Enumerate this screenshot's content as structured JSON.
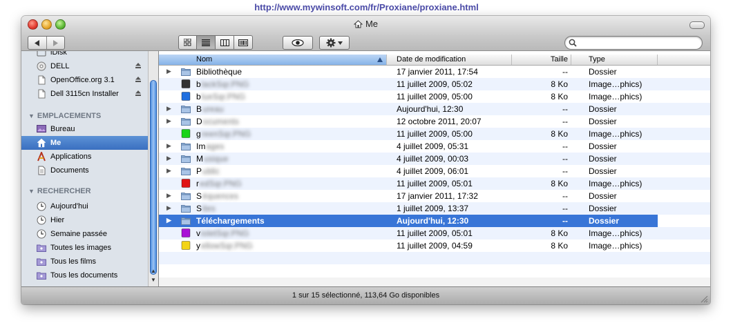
{
  "url_banner": "http://www.mywinsoft.com/fr/Proxiane/proxiane.html",
  "window": {
    "title": "Me"
  },
  "sidebar": {
    "devices": [
      {
        "label": "iDisk",
        "icon": "idisk-icon",
        "eject": false
      },
      {
        "label": "DELL",
        "icon": "disk-icon",
        "eject": true
      },
      {
        "label": "OpenOffice.org 3.1",
        "icon": "volume-icon",
        "eject": true
      },
      {
        "label": "Dell 3115cn Installer",
        "icon": "volume-icon",
        "eject": true
      }
    ],
    "places_header": "EMPLACEMENTS",
    "places": [
      {
        "label": "Bureau",
        "icon": "desktop-icon",
        "selected": false
      },
      {
        "label": "Me",
        "icon": "home-icon",
        "selected": true
      },
      {
        "label": "Applications",
        "icon": "applications-icon",
        "selected": false
      },
      {
        "label": "Documents",
        "icon": "documents-icon",
        "selected": false
      }
    ],
    "search_header": "RECHERCHER",
    "searches": [
      {
        "label": "Aujourd'hui",
        "icon": "clock-icon"
      },
      {
        "label": "Hier",
        "icon": "clock-icon"
      },
      {
        "label": "Semaine passée",
        "icon": "clock-icon"
      },
      {
        "label": "Toutes les images",
        "icon": "smart-folder-icon"
      },
      {
        "label": "Tous les films",
        "icon": "smart-folder-icon"
      },
      {
        "label": "Tous les documents",
        "icon": "smart-folder-icon"
      }
    ]
  },
  "columns": {
    "name": "Nom",
    "date": "Date de modification",
    "size": "Taille",
    "type": "Type"
  },
  "files": [
    {
      "prefix": "Bibliothèque",
      "blurred": "",
      "date": "17 janvier 2011, 17:54",
      "size": "--",
      "type": "Dossier",
      "kind": "folder",
      "color": "#8fb0d8",
      "selected": false
    },
    {
      "prefix": "b",
      "blurred": "lackSqr.PNG",
      "date": "11 juillet 2009, 05:02",
      "size": "8 Ko",
      "type": "Image…phics)",
      "kind": "image",
      "color": "#333333",
      "selected": false
    },
    {
      "prefix": "b",
      "blurred": "lueSqr.PNG",
      "date": "11 juillet 2009, 05:00",
      "size": "8 Ko",
      "type": "Image…phics)",
      "kind": "image",
      "color": "#1f6fe0",
      "selected": false
    },
    {
      "prefix": "B",
      "blurred": "ureau",
      "date": "Aujourd'hui, 12:30",
      "size": "--",
      "type": "Dossier",
      "kind": "folder",
      "color": "#8fb0d8",
      "selected": false
    },
    {
      "prefix": "D",
      "blurred": "ocuments",
      "date": "12 octobre 2011, 20:07",
      "size": "--",
      "type": "Dossier",
      "kind": "folder",
      "color": "#8fb0d8",
      "selected": false
    },
    {
      "prefix": "g",
      "blurred": "reenSqr.PNG",
      "date": "11 juillet 2009, 05:00",
      "size": "8 Ko",
      "type": "Image…phics)",
      "kind": "image",
      "color": "#19d419",
      "selected": false
    },
    {
      "prefix": "Im",
      "blurred": "ages",
      "date": "4 juillet 2009, 05:31",
      "size": "--",
      "type": "Dossier",
      "kind": "folder",
      "color": "#8fb0d8",
      "selected": false
    },
    {
      "prefix": "M",
      "blurred": "usique",
      "date": "4 juillet 2009, 00:03",
      "size": "--",
      "type": "Dossier",
      "kind": "folder",
      "color": "#8fb0d8",
      "selected": false
    },
    {
      "prefix": "P",
      "blurred": "ublic",
      "date": "4 juillet 2009, 06:01",
      "size": "--",
      "type": "Dossier",
      "kind": "folder",
      "color": "#8fb0d8",
      "selected": false
    },
    {
      "prefix": "r",
      "blurred": "edSqr.PNG",
      "date": "11 juillet 2009, 05:01",
      "size": "8 Ko",
      "type": "Image…phics)",
      "kind": "image",
      "color": "#e01515",
      "selected": false
    },
    {
      "prefix": "S",
      "blurred": "équences",
      "date": "17 janvier 2011, 17:32",
      "size": "--",
      "type": "Dossier",
      "kind": "folder",
      "color": "#8fb0d8",
      "selected": false
    },
    {
      "prefix": "S",
      "blurred": "ites",
      "date": "1 juillet 2009, 13:37",
      "size": "--",
      "type": "Dossier",
      "kind": "folder",
      "color": "#8fb0d8",
      "selected": false
    },
    {
      "prefix": "Téléchargements",
      "blurred": "",
      "date": "Aujourd'hui, 12:30",
      "size": "--",
      "type": "Dossier",
      "kind": "folder",
      "color": "#8fb0d8",
      "selected": true
    },
    {
      "prefix": "v",
      "blurred": "ioletSqr.PNG",
      "date": "11 juillet 2009, 05:01",
      "size": "8 Ko",
      "type": "Image…phics)",
      "kind": "image",
      "color": "#a912d6",
      "selected": false
    },
    {
      "prefix": "y",
      "blurred": "ellowSqr.PNG",
      "date": "11 juillet 2009, 04:59",
      "size": "8 Ko",
      "type": "Image…phics)",
      "kind": "image",
      "color": "#f3d416",
      "selected": false
    }
  ],
  "status": "1 sur 15 sélectionné, 113,64 Go disponibles",
  "toolbar": {
    "view_mode": "list"
  }
}
